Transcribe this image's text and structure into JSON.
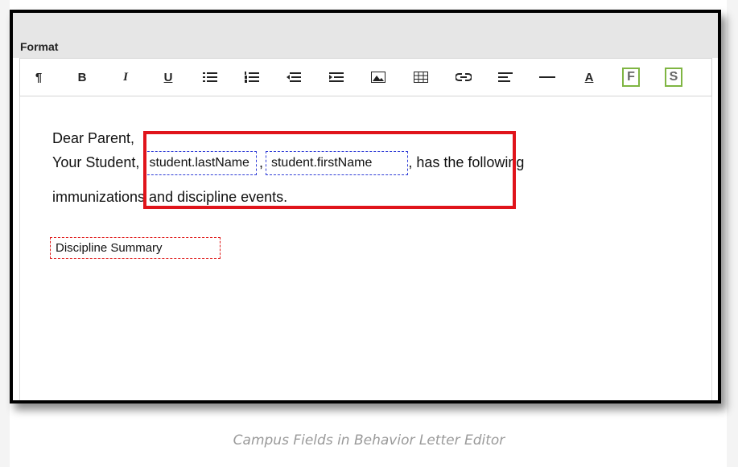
{
  "editor": {
    "section_title": "Format",
    "toolbar": [
      {
        "name": "paragraph-icon",
        "glyph": "¶"
      },
      {
        "name": "bold-button",
        "glyph": "B"
      },
      {
        "name": "italic-button",
        "glyph": "I"
      },
      {
        "name": "underline-button",
        "glyph": "U"
      },
      {
        "name": "bulleted-list-icon",
        "glyph": ""
      },
      {
        "name": "numbered-list-icon",
        "glyph": ""
      },
      {
        "name": "outdent-icon",
        "glyph": ""
      },
      {
        "name": "indent-icon",
        "glyph": ""
      },
      {
        "name": "image-icon",
        "glyph": ""
      },
      {
        "name": "table-icon",
        "glyph": ""
      },
      {
        "name": "link-icon",
        "glyph": ""
      },
      {
        "name": "align-icon",
        "glyph": ""
      },
      {
        "name": "horizontal-rule-icon",
        "glyph": ""
      },
      {
        "name": "font-color-button",
        "glyph": "A"
      },
      {
        "name": "fields-button",
        "glyph": "F"
      },
      {
        "name": "subreports-button",
        "glyph": "S"
      }
    ],
    "body": {
      "line1": "Dear Parent,",
      "line2_prefix": "Your Student, ",
      "field_last_name": "student.lastName",
      "comma": ",",
      "field_first_name": "student.firstName",
      "line2_suffix": ", has the following",
      "line3": "immunizations and discipline events.",
      "summary_field": "Discipline Summary"
    }
  },
  "caption": "Campus Fields in Behavior Letter Editor",
  "colors": {
    "highlight": "#e0141b",
    "field_border": "#2e3cd6",
    "summary_border": "#e01b1b",
    "accent_green": "#7fb542"
  }
}
